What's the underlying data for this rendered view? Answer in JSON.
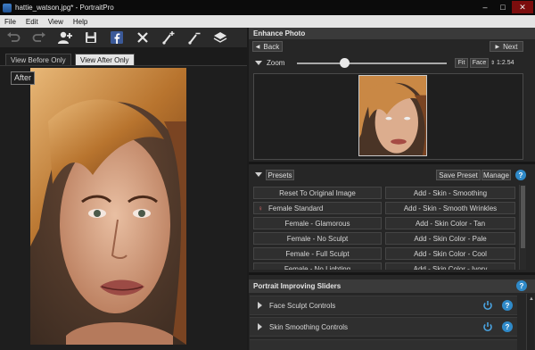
{
  "window": {
    "title": "hattie_watson.jpg* - PortraitPro",
    "minimize": "–",
    "maximize": "□",
    "close": "✕"
  },
  "menu": [
    "File",
    "Edit",
    "View",
    "Help"
  ],
  "toolbar": {
    "icons": [
      "undo-icon",
      "redo-icon",
      "add-person-icon",
      "save-icon",
      "facebook-icon",
      "close-icon",
      "brush-add-icon",
      "brush-remove-icon",
      "layers-icon"
    ]
  },
  "view_tabs": {
    "before": "View Before Only",
    "after": "View After Only",
    "active": "after"
  },
  "image_label": "After",
  "enhance": {
    "header": "Enhance Photo",
    "back": "Back",
    "next": "Next",
    "zoom_label": "Zoom",
    "zoom_level": 0.32,
    "fit": "Fit",
    "face": "Face",
    "zoom_value": "1:2.54"
  },
  "presets": {
    "label": "Presets",
    "save": "Save Preset",
    "manage": "Manage",
    "left": [
      "Reset To Original Image",
      "Female Standard",
      "Female - Glamorous",
      "Female - No Sculpt",
      "Female - Full Sculpt",
      "Female - No Lighting"
    ],
    "right": [
      "Add - Skin - Smoothing",
      "Add - Skin - Smooth Wrinkles",
      "Add - Skin Color - Tan",
      "Add - Skin Color - Pale",
      "Add - Skin Color - Cool",
      "Add - Skin Color - Ivory"
    ]
  },
  "sliders": {
    "header": "Portrait Improving Sliders",
    "sections": [
      "Face Sculpt Controls",
      "Skin Smoothing Controls"
    ]
  },
  "colors": {
    "accent_help": "#2f8ac9",
    "power": "#4aa3e0",
    "facebook": "#3b5998"
  }
}
